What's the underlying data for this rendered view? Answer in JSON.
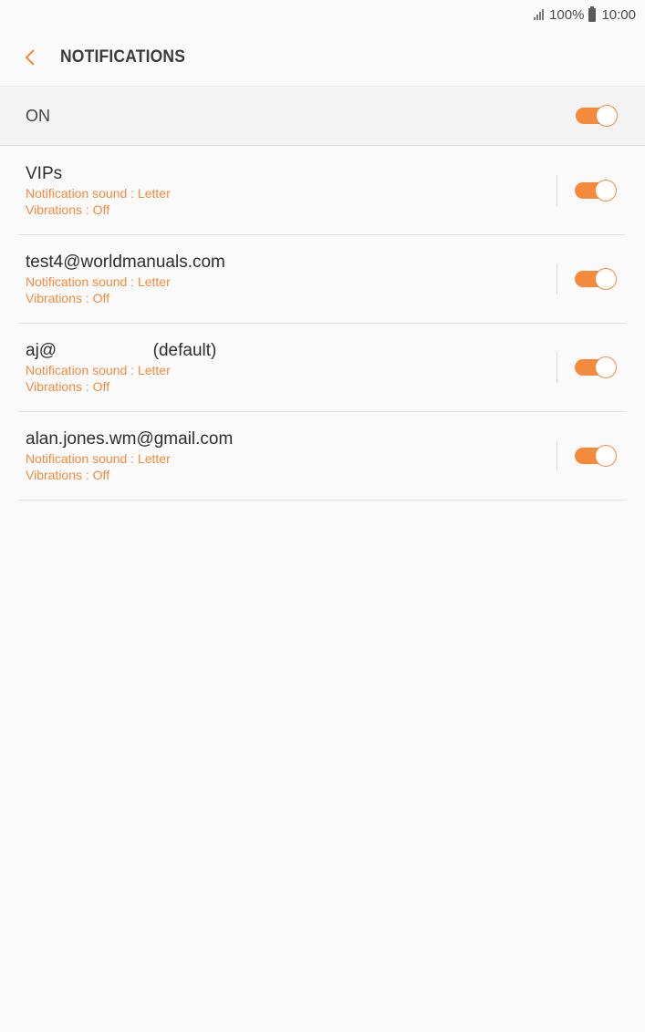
{
  "status_bar": {
    "battery": "100%",
    "time": "10:00"
  },
  "header": {
    "title": "NOTIFICATIONS"
  },
  "master": {
    "label": "ON",
    "enabled": true
  },
  "accounts": [
    {
      "name": "VIPs",
      "sound": "Notification sound : Letter",
      "vibrations": "Vibrations : Off",
      "enabled": true
    },
    {
      "name": "test4@worldmanuals.com",
      "sound": "Notification sound : Letter",
      "vibrations": "Vibrations : Off",
      "enabled": true
    },
    {
      "name": "aj@                    (default)",
      "sound": "Notification sound : Letter",
      "vibrations": "Vibrations : Off",
      "enabled": true
    },
    {
      "name": "alan.jones.wm@gmail.com",
      "sound": "Notification sound : Letter",
      "vibrations": "Vibrations : Off",
      "enabled": true
    }
  ],
  "colors": {
    "accent": "#f48a3c",
    "background": "#fafafa"
  }
}
